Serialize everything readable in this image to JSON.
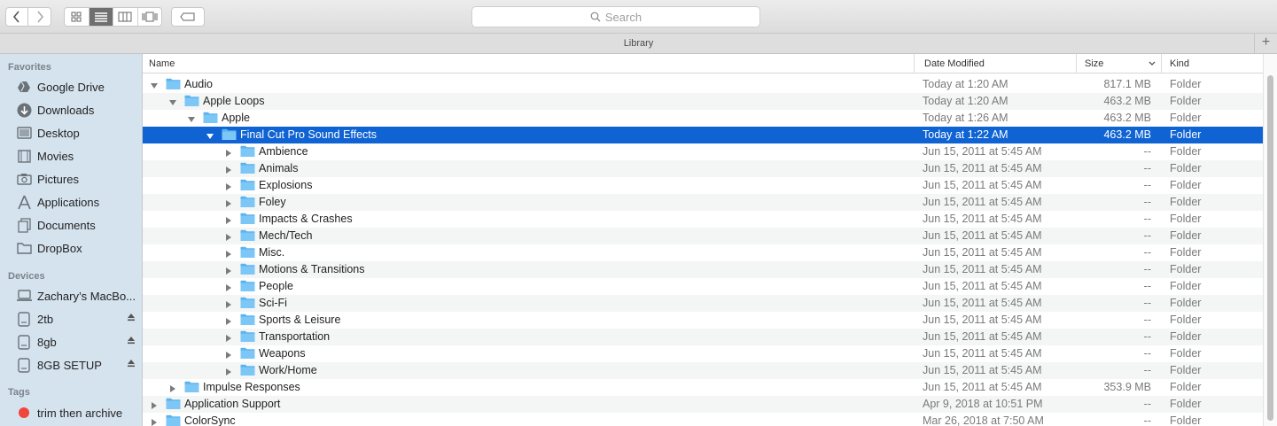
{
  "toolbar": {
    "search_placeholder": "Search",
    "icons": [
      "chevron-left-icon",
      "chevron-right-icon",
      "icon-view-icon",
      "list-view-icon",
      "column-view-icon",
      "cover-flow-icon",
      "tag-icon",
      "search-icon"
    ]
  },
  "pathbar": {
    "title": "Library",
    "add_label": "+"
  },
  "sidebar": {
    "favorites_header": "Favorites",
    "favorites": [
      {
        "label": "Google Drive",
        "icon": "google-drive-icon"
      },
      {
        "label": "Downloads",
        "icon": "downloads-icon"
      },
      {
        "label": "Desktop",
        "icon": "desktop-icon"
      },
      {
        "label": "Movies",
        "icon": "movies-icon"
      },
      {
        "label": "Pictures",
        "icon": "pictures-icon"
      },
      {
        "label": "Applications",
        "icon": "applications-icon"
      },
      {
        "label": "Documents",
        "icon": "documents-icon"
      },
      {
        "label": "DropBox",
        "icon": "folder-icon"
      }
    ],
    "devices_header": "Devices",
    "devices": [
      {
        "label": "Zachary’s MacBo...",
        "icon": "laptop-icon",
        "eject": false
      },
      {
        "label": "2tb",
        "icon": "drive-icon",
        "eject": true
      },
      {
        "label": "8gb",
        "icon": "drive-icon",
        "eject": true
      },
      {
        "label": "8GB SETUP",
        "icon": "drive-icon",
        "eject": true
      }
    ],
    "tags_header": "Tags",
    "tags": [
      {
        "label": "trim then archive",
        "color": "#f0463c"
      }
    ]
  },
  "columns": {
    "name": "Name",
    "date": "Date Modified",
    "size": "Size",
    "kind": "Kind"
  },
  "rows": [
    {
      "name": "Audio",
      "level": 0,
      "expanded": true,
      "date": "Today at 1:20 AM",
      "size": "817.1 MB",
      "kind": "Folder"
    },
    {
      "name": "Apple Loops",
      "level": 1,
      "expanded": true,
      "date": "Today at 1:20 AM",
      "size": "463.2 MB",
      "kind": "Folder"
    },
    {
      "name": "Apple",
      "level": 2,
      "expanded": true,
      "date": "Today at 1:26 AM",
      "size": "463.2 MB",
      "kind": "Folder"
    },
    {
      "name": "Final Cut Pro Sound Effects",
      "level": 3,
      "expanded": true,
      "selected": true,
      "date": "Today at 1:22 AM",
      "size": "463.2 MB",
      "kind": "Folder"
    },
    {
      "name": "Ambience",
      "level": 4,
      "expanded": false,
      "date": "Jun 15, 2011 at 5:45 AM",
      "size": "--",
      "kind": "Folder"
    },
    {
      "name": "Animals",
      "level": 4,
      "expanded": false,
      "date": "Jun 15, 2011 at 5:45 AM",
      "size": "--",
      "kind": "Folder"
    },
    {
      "name": "Explosions",
      "level": 4,
      "expanded": false,
      "date": "Jun 15, 2011 at 5:45 AM",
      "size": "--",
      "kind": "Folder"
    },
    {
      "name": "Foley",
      "level": 4,
      "expanded": false,
      "date": "Jun 15, 2011 at 5:45 AM",
      "size": "--",
      "kind": "Folder"
    },
    {
      "name": "Impacts & Crashes",
      "level": 4,
      "expanded": false,
      "date": "Jun 15, 2011 at 5:45 AM",
      "size": "--",
      "kind": "Folder"
    },
    {
      "name": "Mech/Tech",
      "level": 4,
      "expanded": false,
      "date": "Jun 15, 2011 at 5:45 AM",
      "size": "--",
      "kind": "Folder"
    },
    {
      "name": "Misc.",
      "level": 4,
      "expanded": false,
      "date": "Jun 15, 2011 at 5:45 AM",
      "size": "--",
      "kind": "Folder"
    },
    {
      "name": "Motions & Transitions",
      "level": 4,
      "expanded": false,
      "date": "Jun 15, 2011 at 5:45 AM",
      "size": "--",
      "kind": "Folder"
    },
    {
      "name": "People",
      "level": 4,
      "expanded": false,
      "date": "Jun 15, 2011 at 5:45 AM",
      "size": "--",
      "kind": "Folder"
    },
    {
      "name": "Sci-Fi",
      "level": 4,
      "expanded": false,
      "date": "Jun 15, 2011 at 5:45 AM",
      "size": "--",
      "kind": "Folder"
    },
    {
      "name": "Sports & Leisure",
      "level": 4,
      "expanded": false,
      "date": "Jun 15, 2011 at 5:45 AM",
      "size": "--",
      "kind": "Folder"
    },
    {
      "name": "Transportation",
      "level": 4,
      "expanded": false,
      "date": "Jun 15, 2011 at 5:45 AM",
      "size": "--",
      "kind": "Folder"
    },
    {
      "name": "Weapons",
      "level": 4,
      "expanded": false,
      "date": "Jun 15, 2011 at 5:45 AM",
      "size": "--",
      "kind": "Folder"
    },
    {
      "name": "Work/Home",
      "level": 4,
      "expanded": false,
      "date": "Jun 15, 2011 at 5:45 AM",
      "size": "--",
      "kind": "Folder"
    },
    {
      "name": "Impulse Responses",
      "level": 1,
      "expanded": false,
      "date": "Jun 15, 2011 at 5:45 AM",
      "size": "353.9 MB",
      "kind": "Folder"
    },
    {
      "name": "Application Support",
      "level": 0,
      "expanded": false,
      "date": "Apr 9, 2018 at 10:51 PM",
      "size": "--",
      "kind": "Folder"
    },
    {
      "name": "ColorSync",
      "level": 0,
      "expanded": false,
      "date": "Mar 26, 2018 at 7:50 AM",
      "size": "--",
      "kind": "Folder"
    }
  ],
  "colors": {
    "selection": "#0f63d3",
    "folder": "#6cc2f5",
    "sidebar": "#d5e3ee"
  }
}
